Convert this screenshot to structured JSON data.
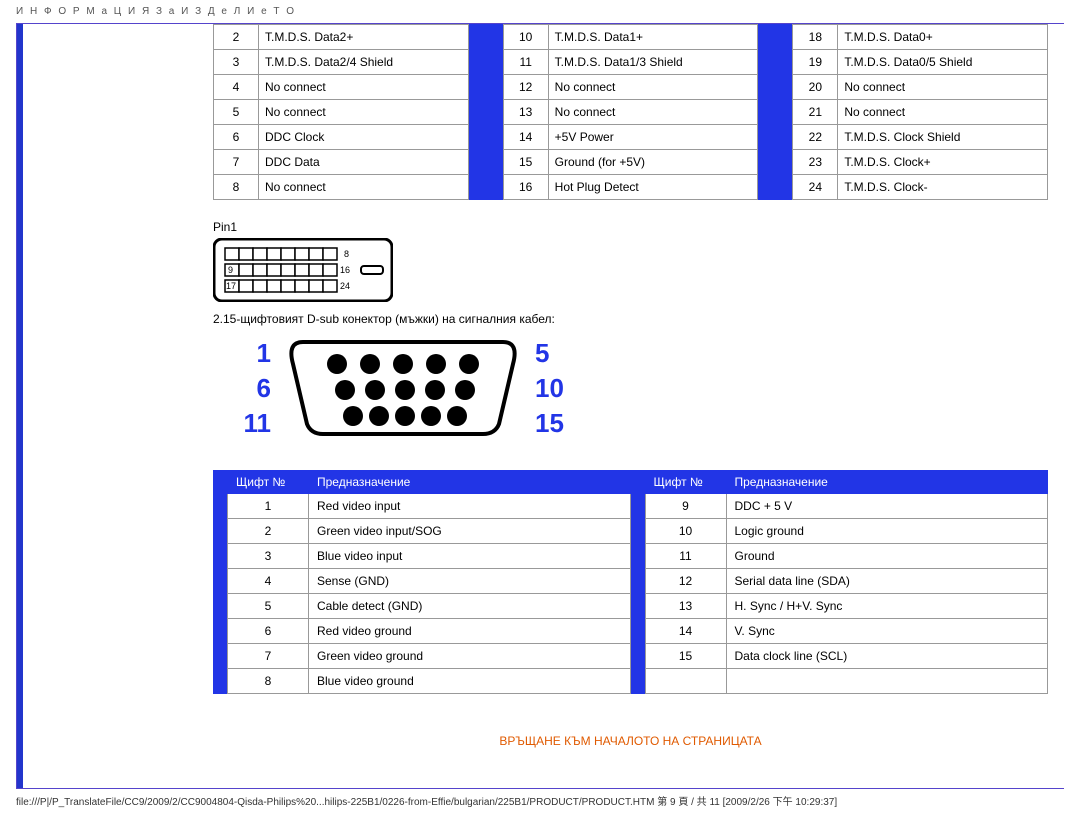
{
  "page_header": "И Н Ф О Р М а Ц И Я  З а  И З Д е Л И е Т О",
  "dvi_table": {
    "col1": [
      {
        "n": "2",
        "t": "T.M.D.S. Data2+"
      },
      {
        "n": "3",
        "t": "T.M.D.S. Data2/4 Shield"
      },
      {
        "n": "4",
        "t": "No connect"
      },
      {
        "n": "5",
        "t": "No connect"
      },
      {
        "n": "6",
        "t": "DDC Clock"
      },
      {
        "n": "7",
        "t": "DDC Data"
      },
      {
        "n": "8",
        "t": "No connect"
      }
    ],
    "col2": [
      {
        "n": "10",
        "t": "T.M.D.S. Data1+"
      },
      {
        "n": "11",
        "t": "T.M.D.S. Data1/3 Shield"
      },
      {
        "n": "12",
        "t": "No connect"
      },
      {
        "n": "13",
        "t": "No connect"
      },
      {
        "n": "14",
        "t": "+5V Power"
      },
      {
        "n": "15",
        "t": "Ground (for +5V)"
      },
      {
        "n": "16",
        "t": "Hot Plug Detect"
      }
    ],
    "col3": [
      {
        "n": "18",
        "t": "T.M.D.S. Data0+"
      },
      {
        "n": "19",
        "t": "T.M.D.S. Data0/5 Shield"
      },
      {
        "n": "20",
        "t": "No connect"
      },
      {
        "n": "21",
        "t": "No connect"
      },
      {
        "n": "22",
        "t": "T.M.D.S. Clock Shield"
      },
      {
        "n": "23",
        "t": "T.M.D.S. Clock+"
      },
      {
        "n": "24",
        "t": "T.M.D.S. Clock-"
      }
    ]
  },
  "dvi_pin1_label": "Pin1",
  "dvi_corner_labels": {
    "tr": "8",
    "ml": "9",
    "mr": "16",
    "bl": "17",
    "br": "24"
  },
  "dsub_heading": "2.15-щифтовият D-sub конектор (мъжки) на сигналния кабел:",
  "vga_nums_left": [
    "1",
    "6",
    "11"
  ],
  "vga_nums_right": [
    "5",
    "10",
    "15"
  ],
  "vga_headers": {
    "pin": "Щифт №",
    "assign": "Предназначение"
  },
  "vga_table": {
    "left": [
      {
        "n": "1",
        "t": "Red video input"
      },
      {
        "n": "2",
        "t": "Green video input/SOG"
      },
      {
        "n": "3",
        "t": "Blue video input"
      },
      {
        "n": "4",
        "t": "Sense (GND)"
      },
      {
        "n": "5",
        "t": "Cable detect (GND)"
      },
      {
        "n": "6",
        "t": "Red video ground"
      },
      {
        "n": "7",
        "t": "Green video ground"
      },
      {
        "n": "8",
        "t": "Blue video ground"
      }
    ],
    "right": [
      {
        "n": "9",
        "t": "DDC + 5 V"
      },
      {
        "n": "10",
        "t": "Logic ground"
      },
      {
        "n": "11",
        "t": "Ground"
      },
      {
        "n": "12",
        "t": "Serial data line (SDA)"
      },
      {
        "n": "13",
        "t": "H. Sync / H+V. Sync"
      },
      {
        "n": "14",
        "t": "V. Sync"
      },
      {
        "n": "15",
        "t": "Data clock line (SCL)"
      }
    ]
  },
  "back_to_top": "ВРЪЩАНЕ КЪМ НАЧАЛОТО НА СТРАНИЦАТА",
  "footer_src": "file:///P|/P_TranslateFile/CC9/2009/2/CC9004804-Qisda-Philips%20...hilips-225B1/0226-from-Effie/bulgarian/225B1/PRODUCT/PRODUCT.HTM 第 9 頁 / 共 11 [2009/2/26 下午 10:29:37]"
}
